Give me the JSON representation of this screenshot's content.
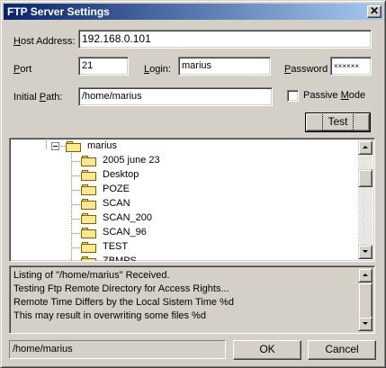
{
  "window": {
    "title": "FTP Server Settings",
    "close_glyph": "✕"
  },
  "form": {
    "host_label_u": "H",
    "host_label_rest": "ost Address:",
    "host_value": "192.168.0.101",
    "port_label_u": "P",
    "port_label_rest": "ort",
    "port_value": "21",
    "login_label_u": "L",
    "login_label_rest": "ogin:",
    "login_value": "marius",
    "password_label_u": "P",
    "password_label_rest": "assword",
    "password_value": "××××××",
    "path_label_pre": "Initial ",
    "path_label_u": "P",
    "path_label_rest": "ath:",
    "path_value": "/home/marius",
    "passive_label_pre": "Passive ",
    "passive_label_u": "M",
    "passive_label_rest": "ode",
    "passive_checked": false,
    "test_button": "Test"
  },
  "tree": {
    "root": "marius",
    "children": [
      "2005 june 23",
      "Desktop",
      "POZE",
      "SCAN",
      "SCAN_200",
      "SCAN_96",
      "TEST",
      "ZBMPS"
    ]
  },
  "log": {
    "lines": [
      "Listing of \"/home/marius\" Received.",
      "Testing Ftp Remote Directory for Access Rights...",
      "Remote Time Differs by the Local Sistem Time %d",
      "This may result in overwriting some files %d"
    ]
  },
  "footer": {
    "status_path": "/home/marius",
    "ok_button": "OK",
    "cancel_button": "Cancel"
  },
  "colors": {
    "title_start": "#0a246a",
    "title_end": "#a6caf0",
    "face": "#d4d0c8",
    "folder": "#f8e890"
  },
  "icons": {
    "close": "close-icon",
    "folder": "folder-icon",
    "collapse": "tree-collapse-icon",
    "scroll_up": "chevron-up-icon",
    "scroll_down": "chevron-down-icon"
  }
}
